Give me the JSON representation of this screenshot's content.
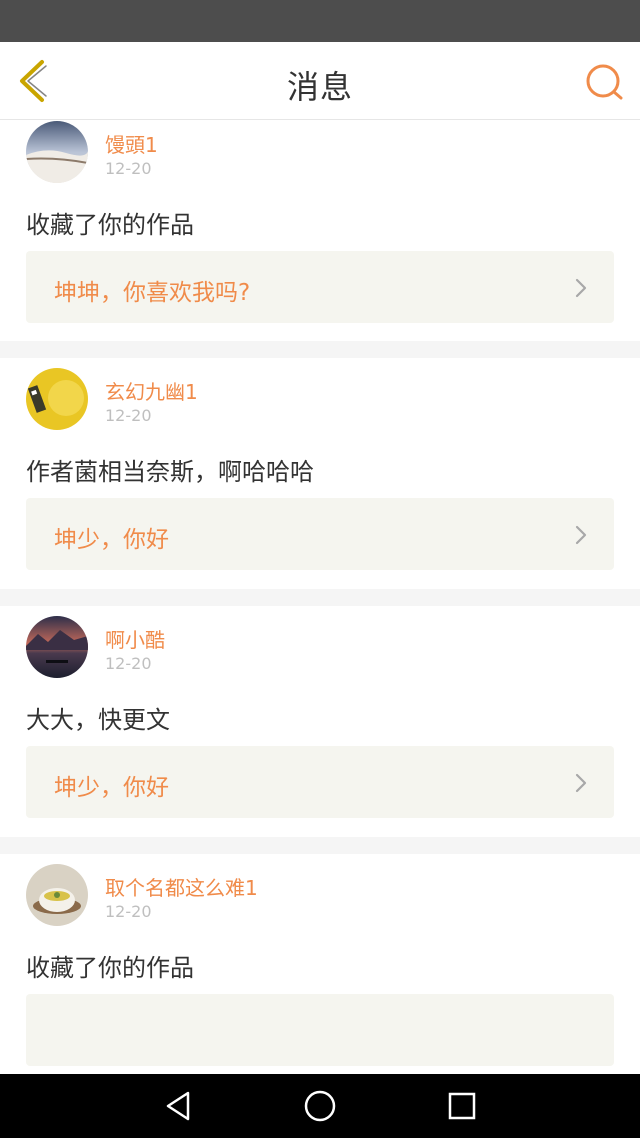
{
  "header": {
    "title": "消息"
  },
  "messages": [
    {
      "username": "馒頭1",
      "date": "12-20",
      "content": "收藏了你的作品",
      "reference": "坤坤，你喜欢我吗?"
    },
    {
      "username": "玄幻九幽1",
      "date": "12-20",
      "content": "作者菌相当奈斯，啊哈哈哈",
      "reference": "坤少，你好"
    },
    {
      "username": "啊小酷",
      "date": "12-20",
      "content": "大大，快更文",
      "reference": "坤少，你好"
    },
    {
      "username": "取个名都这么难1",
      "date": "12-20",
      "content": "收藏了你的作品",
      "reference": ""
    }
  ],
  "colors": {
    "accent": "#f08b4a",
    "back_icon": "#c9a500",
    "status_bar": "#4d4d4d",
    "card_ref_bg": "#f5f5ef"
  },
  "icons": {
    "back": "chevron-left-icon",
    "search": "search-icon",
    "ref": "chevron-right-icon",
    "nav_back": "triangle-back-icon",
    "nav_home": "circle-home-icon",
    "nav_recent": "square-recent-icon"
  }
}
